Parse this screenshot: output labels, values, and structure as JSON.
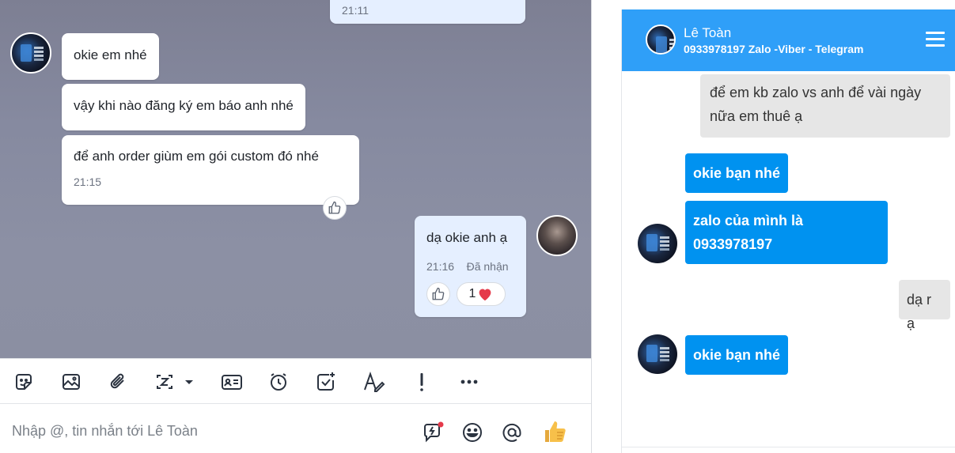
{
  "chat": {
    "messages": [
      {
        "time": "21:11"
      },
      {
        "text": "okie em nhé"
      },
      {
        "text": "vậy khi nào đăng ký em báo anh nhé"
      },
      {
        "text": "để anh order giùm em gói custom đó nhé",
        "time": "21:15"
      },
      {
        "text": "dạ okie anh ạ",
        "time": "21:16",
        "status": "Đã nhận",
        "reaction_count": "1"
      }
    ]
  },
  "toolbar": {
    "icons": [
      "sticker-icon",
      "image-icon",
      "attachment-icon",
      "screenshot-icon",
      "contact-card-icon",
      "reminder-icon",
      "todo-icon",
      "format-text-icon",
      "urgent-icon",
      "more-icon"
    ]
  },
  "composer": {
    "placeholder": "Nhập @, tin nhắn tới Lê Toàn"
  },
  "widget": {
    "name": "Lê Toàn",
    "subtitle": "0933978197 Zalo -Viber - Telegram",
    "messages": [
      {
        "text": "để em kb zalo vs anh để vài ngày nữa em thuê ạ"
      },
      {
        "text": "okie bạn nhé"
      },
      {
        "text": "zalo của mình là 0933978197"
      },
      {
        "text": "dạ r ạ"
      },
      {
        "text": "okie bạn nhé"
      }
    ]
  },
  "colors": {
    "header": "#2f9ff8",
    "incoming_bubble": "#0092f0",
    "my_bubble": "#e5efff"
  }
}
